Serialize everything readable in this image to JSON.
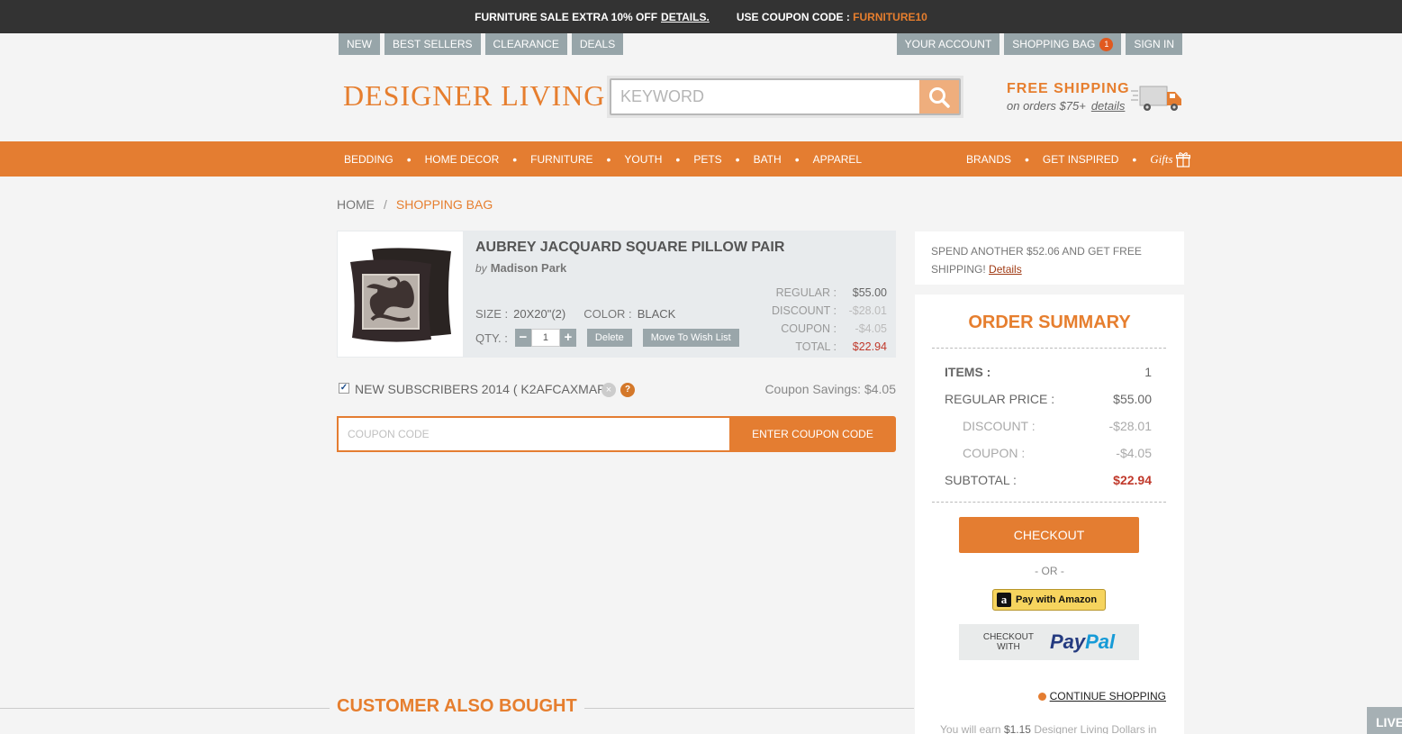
{
  "promo": {
    "sale_text": "FURNITURE SALE EXTRA 10% OFF",
    "details_link": "DETAILS.",
    "coupon_prefix": "USE COUPON CODE :",
    "coupon_code": "FURNITURE10"
  },
  "utility_nav": {
    "left": [
      "NEW",
      "BEST SELLERS",
      "CLEARANCE",
      "DEALS"
    ],
    "account": "YOUR ACCOUNT",
    "bag": "SHOPPING BAG",
    "bag_count": "1",
    "sign_in": "SIGN IN"
  },
  "logo": "DESIGNER LIVING",
  "search": {
    "placeholder": "KEYWORD",
    "icon": "search-icon"
  },
  "free_shipping": {
    "title": "FREE SHIPPING",
    "subtitle": "on orders $75+",
    "details": "details",
    "icon": "truck-icon"
  },
  "main_nav": {
    "left": [
      "BEDDING",
      "HOME DECOR",
      "FURNITURE",
      "YOUTH",
      "PETS",
      "BATH",
      "APPAREL"
    ],
    "right": [
      "BRANDS",
      "GET INSPIRED"
    ],
    "gifts": "Gifts",
    "separator": "•"
  },
  "breadcrumb": {
    "home": "HOME",
    "separator": "/",
    "current": "SHOPPING BAG"
  },
  "cart_item": {
    "title": "AUBREY JACQUARD SQUARE PILLOW PAIR",
    "by": "by",
    "brand": "Madison Park",
    "size_label": "SIZE :",
    "size_value": "20X20\"(2)",
    "color_label": "COLOR :",
    "color_value": "BLACK",
    "qty_label": "QTY. :",
    "qty_value": "1",
    "minus": "−",
    "plus": "+",
    "delete": "Delete",
    "wishlist": "Move To Wish List",
    "prices": {
      "regular_label": "REGULAR :",
      "regular": "$55.00",
      "discount_label": "DISCOUNT :",
      "discount": "-$28.01",
      "coupon_label": "COUPON :",
      "coupon": "-$4.05",
      "total_label": "TOTAL :",
      "total": "$22.94"
    }
  },
  "applied_coupon": {
    "checked": "✓",
    "name": "NEW SUBSCRIBERS 2014 ( K2AFCAXMAP)",
    "remove": "×",
    "help": "?",
    "savings": "Coupon Savings: $4.05"
  },
  "coupon_form": {
    "placeholder": "COUPON CODE",
    "button": "ENTER COUPON CODE"
  },
  "also_bought": "CUSTOMER ALSO BOUGHT",
  "spend_notice": {
    "text": "SPEND ANOTHER $52.06 AND GET FREE SHIPPING!",
    "link": "Details"
  },
  "order_summary": {
    "title": "ORDER SUMMARY",
    "items_label": "ITEMS :",
    "items": "1",
    "regular_label": "REGULAR PRICE :",
    "regular": "$55.00",
    "discount_label": "DISCOUNT :",
    "discount": "-$28.01",
    "coupon_label": "COUPON :",
    "coupon": "-$4.05",
    "subtotal_label": "SUBTOTAL :",
    "subtotal": "$22.94",
    "checkout": "CHECKOUT",
    "or": "- OR -",
    "amazon": "Pay with Amazon",
    "amazon_logo": "a",
    "paypal_small_1": "CHECKOUT",
    "paypal_small_2": "WITH",
    "paypal_1": "Pay",
    "paypal_2": "Pal",
    "continue": "CONTINUE SHOPPING",
    "earn_prefix": "You will earn",
    "earn_amount": "$1.15",
    "earn_suffix": "Designer Living Dollars in"
  },
  "live_chat": "LIVE",
  "colors": {
    "orange": "#e47d31",
    "dark_bar": "#333333",
    "gray_button": "#97a5a9",
    "price_red": "#c0392b"
  }
}
